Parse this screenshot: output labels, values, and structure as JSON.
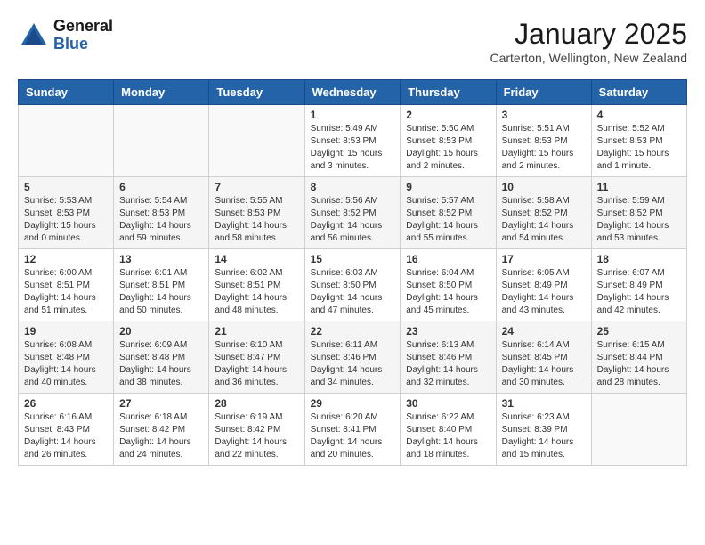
{
  "header": {
    "logo_general": "General",
    "logo_blue": "Blue",
    "month_title": "January 2025",
    "location": "Carterton, Wellington, New Zealand"
  },
  "days_of_week": [
    "Sunday",
    "Monday",
    "Tuesday",
    "Wednesday",
    "Thursday",
    "Friday",
    "Saturday"
  ],
  "weeks": [
    [
      {
        "num": "",
        "info": ""
      },
      {
        "num": "",
        "info": ""
      },
      {
        "num": "",
        "info": ""
      },
      {
        "num": "1",
        "info": "Sunrise: 5:49 AM\nSunset: 8:53 PM\nDaylight: 15 hours\nand 3 minutes."
      },
      {
        "num": "2",
        "info": "Sunrise: 5:50 AM\nSunset: 8:53 PM\nDaylight: 15 hours\nand 2 minutes."
      },
      {
        "num": "3",
        "info": "Sunrise: 5:51 AM\nSunset: 8:53 PM\nDaylight: 15 hours\nand 2 minutes."
      },
      {
        "num": "4",
        "info": "Sunrise: 5:52 AM\nSunset: 8:53 PM\nDaylight: 15 hours\nand 1 minute."
      }
    ],
    [
      {
        "num": "5",
        "info": "Sunrise: 5:53 AM\nSunset: 8:53 PM\nDaylight: 15 hours\nand 0 minutes."
      },
      {
        "num": "6",
        "info": "Sunrise: 5:54 AM\nSunset: 8:53 PM\nDaylight: 14 hours\nand 59 minutes."
      },
      {
        "num": "7",
        "info": "Sunrise: 5:55 AM\nSunset: 8:53 PM\nDaylight: 14 hours\nand 58 minutes."
      },
      {
        "num": "8",
        "info": "Sunrise: 5:56 AM\nSunset: 8:52 PM\nDaylight: 14 hours\nand 56 minutes."
      },
      {
        "num": "9",
        "info": "Sunrise: 5:57 AM\nSunset: 8:52 PM\nDaylight: 14 hours\nand 55 minutes."
      },
      {
        "num": "10",
        "info": "Sunrise: 5:58 AM\nSunset: 8:52 PM\nDaylight: 14 hours\nand 54 minutes."
      },
      {
        "num": "11",
        "info": "Sunrise: 5:59 AM\nSunset: 8:52 PM\nDaylight: 14 hours\nand 53 minutes."
      }
    ],
    [
      {
        "num": "12",
        "info": "Sunrise: 6:00 AM\nSunset: 8:51 PM\nDaylight: 14 hours\nand 51 minutes."
      },
      {
        "num": "13",
        "info": "Sunrise: 6:01 AM\nSunset: 8:51 PM\nDaylight: 14 hours\nand 50 minutes."
      },
      {
        "num": "14",
        "info": "Sunrise: 6:02 AM\nSunset: 8:51 PM\nDaylight: 14 hours\nand 48 minutes."
      },
      {
        "num": "15",
        "info": "Sunrise: 6:03 AM\nSunset: 8:50 PM\nDaylight: 14 hours\nand 47 minutes."
      },
      {
        "num": "16",
        "info": "Sunrise: 6:04 AM\nSunset: 8:50 PM\nDaylight: 14 hours\nand 45 minutes."
      },
      {
        "num": "17",
        "info": "Sunrise: 6:05 AM\nSunset: 8:49 PM\nDaylight: 14 hours\nand 43 minutes."
      },
      {
        "num": "18",
        "info": "Sunrise: 6:07 AM\nSunset: 8:49 PM\nDaylight: 14 hours\nand 42 minutes."
      }
    ],
    [
      {
        "num": "19",
        "info": "Sunrise: 6:08 AM\nSunset: 8:48 PM\nDaylight: 14 hours\nand 40 minutes."
      },
      {
        "num": "20",
        "info": "Sunrise: 6:09 AM\nSunset: 8:48 PM\nDaylight: 14 hours\nand 38 minutes."
      },
      {
        "num": "21",
        "info": "Sunrise: 6:10 AM\nSunset: 8:47 PM\nDaylight: 14 hours\nand 36 minutes."
      },
      {
        "num": "22",
        "info": "Sunrise: 6:11 AM\nSunset: 8:46 PM\nDaylight: 14 hours\nand 34 minutes."
      },
      {
        "num": "23",
        "info": "Sunrise: 6:13 AM\nSunset: 8:46 PM\nDaylight: 14 hours\nand 32 minutes."
      },
      {
        "num": "24",
        "info": "Sunrise: 6:14 AM\nSunset: 8:45 PM\nDaylight: 14 hours\nand 30 minutes."
      },
      {
        "num": "25",
        "info": "Sunrise: 6:15 AM\nSunset: 8:44 PM\nDaylight: 14 hours\nand 28 minutes."
      }
    ],
    [
      {
        "num": "26",
        "info": "Sunrise: 6:16 AM\nSunset: 8:43 PM\nDaylight: 14 hours\nand 26 minutes."
      },
      {
        "num": "27",
        "info": "Sunrise: 6:18 AM\nSunset: 8:42 PM\nDaylight: 14 hours\nand 24 minutes."
      },
      {
        "num": "28",
        "info": "Sunrise: 6:19 AM\nSunset: 8:42 PM\nDaylight: 14 hours\nand 22 minutes."
      },
      {
        "num": "29",
        "info": "Sunrise: 6:20 AM\nSunset: 8:41 PM\nDaylight: 14 hours\nand 20 minutes."
      },
      {
        "num": "30",
        "info": "Sunrise: 6:22 AM\nSunset: 8:40 PM\nDaylight: 14 hours\nand 18 minutes."
      },
      {
        "num": "31",
        "info": "Sunrise: 6:23 AM\nSunset: 8:39 PM\nDaylight: 14 hours\nand 15 minutes."
      },
      {
        "num": "",
        "info": ""
      }
    ]
  ]
}
